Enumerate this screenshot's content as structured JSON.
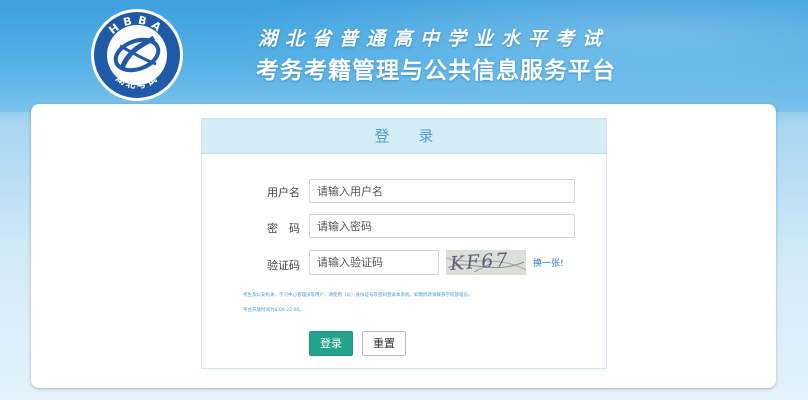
{
  "header": {
    "logo_text_top": "HBBA",
    "logo_text_bottom": "湖北考试",
    "title_line1": "湖北省普通高中学业水平考试",
    "title_line2": "考务考籍管理与公共信息服务平台"
  },
  "login": {
    "panel_title": "登 录",
    "username_label": "用户名",
    "username_placeholder": "请输入用户名",
    "password_label": "密　码",
    "password_placeholder": "请输入密码",
    "captcha_label": "验证码",
    "captcha_placeholder": "请输入验证码",
    "captcha_text": "KF67",
    "refresh_label": "换一张!",
    "note1": "考生及公安机关、学习中心管理员等用户，请使用（公）身份证号及密码登录本系统，如需修改请联系学校管理员。",
    "note2": "平台开放时间为8:00-22:00。",
    "login_button": "登录",
    "reset_button": "重置"
  },
  "colors": {
    "accent": "#24a28b",
    "panel_header": "#d4ecf6",
    "header_blue": "#4aa6de",
    "link": "#2a78c8"
  }
}
